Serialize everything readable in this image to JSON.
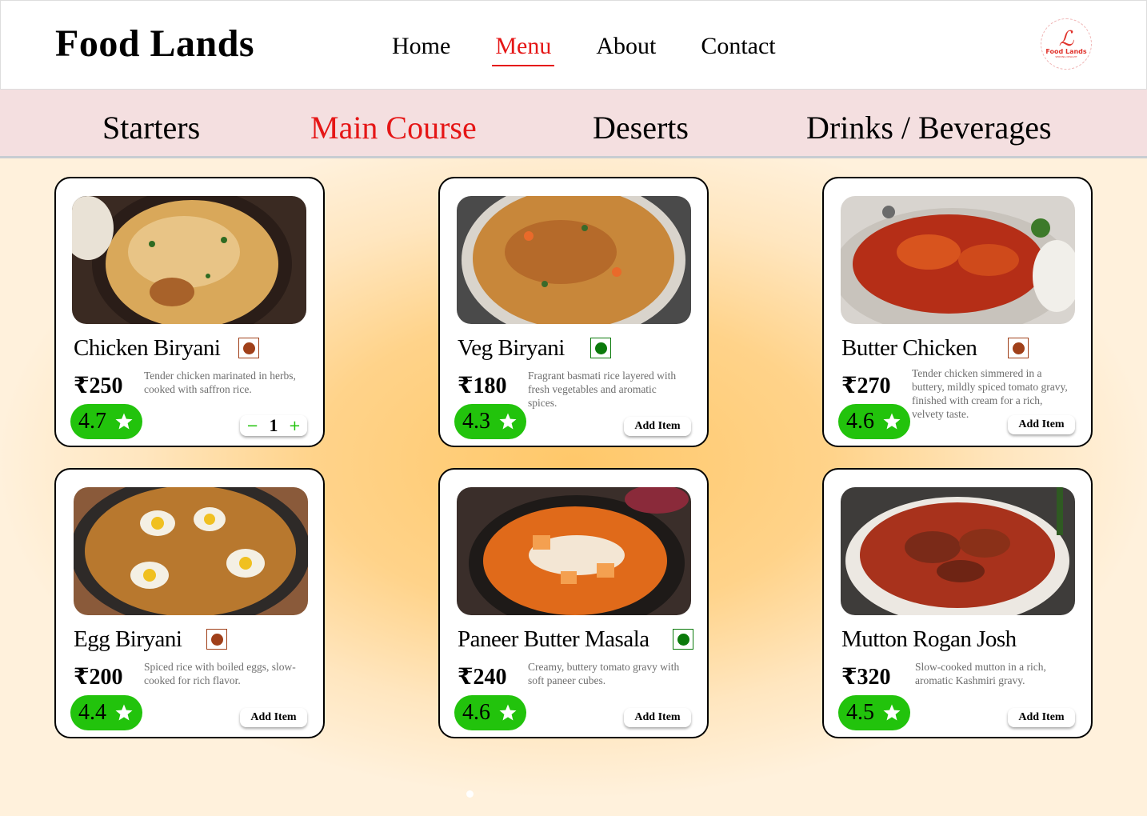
{
  "brand": "Food Lands",
  "nav": [
    "Home",
    "Menu",
    "About",
    "Contact"
  ],
  "nav_active": "Menu",
  "logo": {
    "glyph": "ℒ",
    "text": "Food Lands",
    "sub": "SERVING DELIGHT"
  },
  "categories": [
    "Starters",
    "Main Course",
    "Deserts",
    "Drinks / Beverages"
  ],
  "category_active": "Main Course",
  "items": [
    {
      "name": "Chicken Biryani",
      "type": "non-veg",
      "price": "₹250",
      "desc": "Tender chicken marinated in herbs, cooked with saffron rice.",
      "rating": "4.7",
      "quantity": "1",
      "minus": "−",
      "plus": "+"
    },
    {
      "name": "Veg Biryani",
      "type": "veg",
      "price": "₹180",
      "desc": "Fragrant basmati rice layered with fresh vegetables and aromatic spices.",
      "rating": "4.3",
      "button": "Add Item"
    },
    {
      "name": "Butter Chicken",
      "type": "non-veg",
      "price": "₹270",
      "desc": "Tender chicken simmered in a buttery, mildly spiced tomato gravy, finished with cream for a rich, velvety taste.",
      "rating": "4.6",
      "button": "Add Item"
    },
    {
      "name": "Egg Biryani",
      "type": "non-veg",
      "price": "₹200",
      "desc": "Spiced rice with boiled eggs, slow-cooked for rich flavor.",
      "rating": "4.4",
      "button": "Add Item"
    },
    {
      "name": "Paneer Butter Masala",
      "type": "veg",
      "price": "₹240",
      "desc": "Creamy, buttery tomato gravy with soft paneer cubes.",
      "rating": "4.6",
      "button": "Add Item"
    },
    {
      "name": "Mutton Rogan Josh",
      "type": "non-veg",
      "price": "₹320",
      "desc": "Slow-cooked mutton in a rich, aromatic Kashmiri gravy.",
      "rating": "4.5",
      "button": "Add Item"
    }
  ],
  "colors": {
    "accent": "#e51616",
    "rating_bg": "#22c30c",
    "veg": "#0b7a0b",
    "nonveg": "#a0401a",
    "category_bg": "#f4dfe0"
  }
}
